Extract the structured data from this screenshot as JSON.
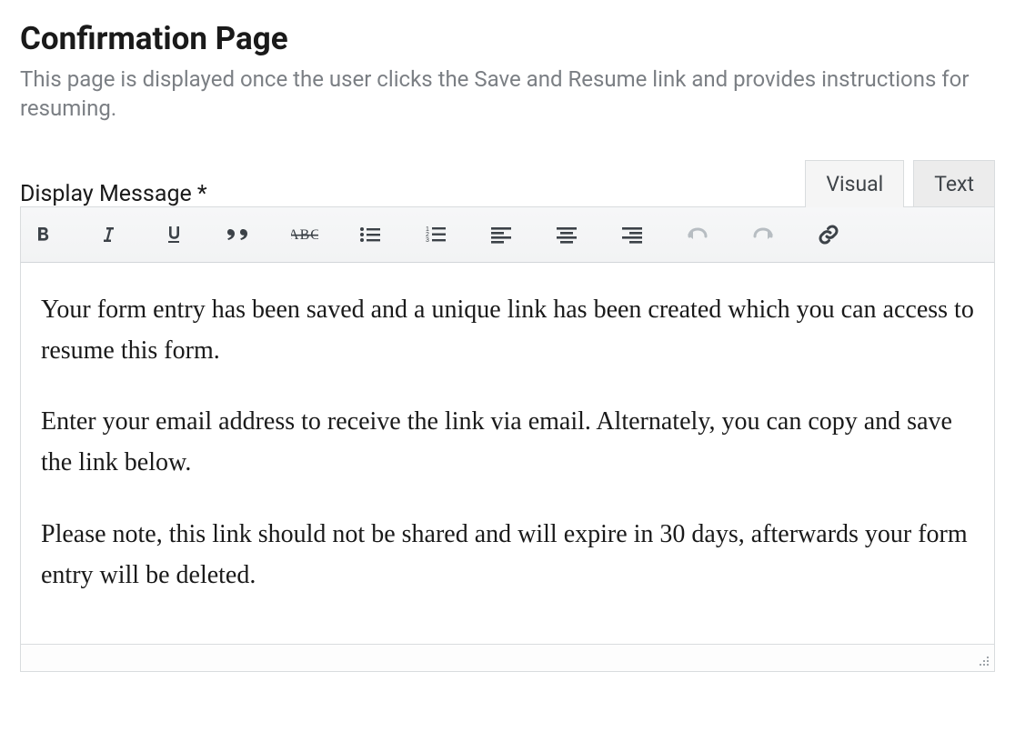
{
  "header": {
    "title": "Confirmation Page",
    "subtitle": "This page is displayed once the user clicks the Save and Resume link and provides instructions for resuming."
  },
  "field": {
    "label": "Display Message *"
  },
  "tabs": {
    "visual": "Visual",
    "text": "Text"
  },
  "toolbar": {
    "bold": "Bold",
    "italic": "Italic",
    "underline": "Underline",
    "blockquote": "Blockquote",
    "strikethrough": "Strikethrough",
    "bulleted_list": "Bulleted list",
    "numbered_list": "Numbered list",
    "align_left": "Align left",
    "align_center": "Align center",
    "align_right": "Align right",
    "undo": "Undo",
    "redo": "Redo",
    "link": "Insert link"
  },
  "editor": {
    "p1": "Your form entry has been saved and a unique link has been created which you can access to resume this form.",
    "p2": "Enter your email address to receive the link via email. Alternately, you can copy and save the link below.",
    "p3": "Please note, this link should not be shared and will expire in 30 days, afterwards your form entry will be deleted."
  }
}
